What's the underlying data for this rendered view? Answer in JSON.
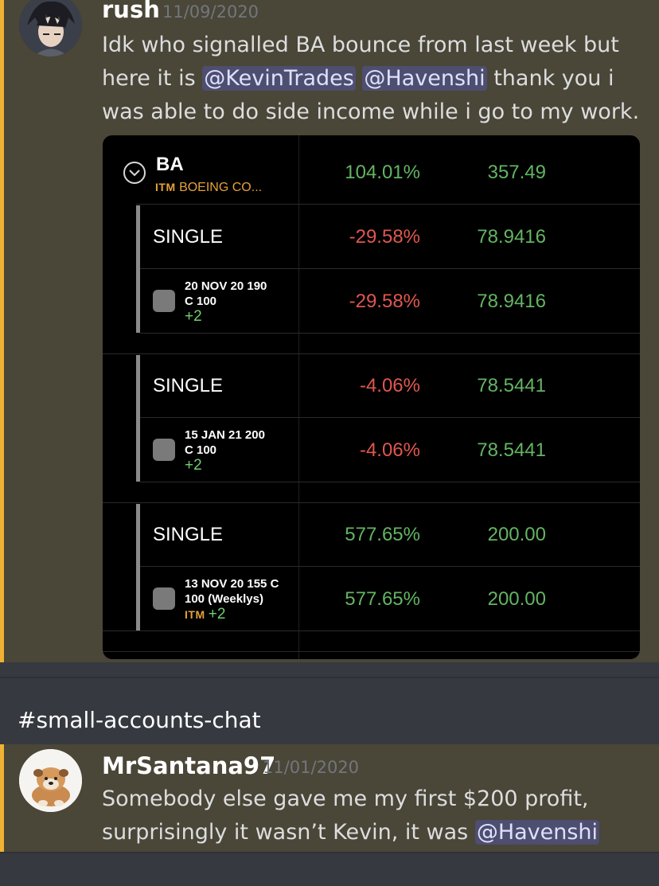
{
  "message1": {
    "author": "rush",
    "timestamp": "11/09/2020",
    "text_line1": "Idk who signalled BA bounce from last week but",
    "text_line2_prefix": "here it is ",
    "mention1": "@KevinTrades",
    "mention2": "@Havenshi",
    "text_line2_suffix": " thank you i",
    "text_line3": "was able to do side income while i go to my work."
  },
  "position": {
    "ticker": "BA",
    "itm": "ITM",
    "company": "BOEING CO...",
    "pct": "104.01%",
    "value": "357.49",
    "legs": [
      {
        "label": "SINGLE",
        "pct": "-29.58%",
        "value": "78.9416",
        "pct_color": "red",
        "contract_line1": "20 NOV 20 190",
        "contract_line2": "C 100",
        "itm": "",
        "qty": "+2",
        "row_pct": "-29.58%",
        "row_value": "78.9416"
      },
      {
        "label": "SINGLE",
        "pct": "-4.06%",
        "value": "78.5441",
        "pct_color": "red",
        "contract_line1": "15 JAN 21 200",
        "contract_line2": "C 100",
        "itm": "",
        "qty": "+2",
        "row_pct": "-4.06%",
        "row_value": "78.5441"
      },
      {
        "label": "SINGLE",
        "pct": "577.65%",
        "value": "200.00",
        "pct_color": "green",
        "contract_line1": "13 NOV 20 155 C",
        "contract_line2": "100 (Weeklys)",
        "itm": "ITM",
        "qty": "+2",
        "row_pct": "577.65%",
        "row_value": "200.00"
      }
    ]
  },
  "channel": {
    "name": "#small-accounts-chat"
  },
  "message2": {
    "author": "MrSantana97",
    "timestamp": "11/01/2020",
    "text_line1": "Somebody else gave me my first $200 profit,",
    "text_line2_prefix": "surprisingly it wasn’t Kevin, it was ",
    "mention": "@Havenshi"
  },
  "colors": {
    "highlight_bar": "#f0b232",
    "message_bg": "#4a4638",
    "gain": "#63b463",
    "loss": "#e0574f"
  }
}
